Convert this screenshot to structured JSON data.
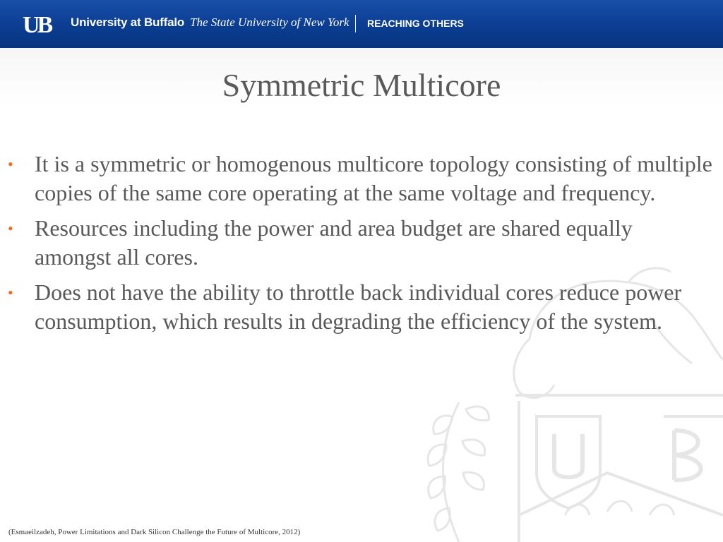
{
  "header": {
    "logo_text": "UB",
    "university": "University at Buffalo",
    "suny": "The State University of New York",
    "tagline": "REACHING OTHERS"
  },
  "slide": {
    "title": "Symmetric Multicore",
    "bullets": [
      "It is a symmetric or homogenous multicore topology consisting of multiple copies of the same core operating at the same voltage and frequency.",
      "Resources including the power and area budget are shared equally amongst all cores.",
      "Does not have the ability to throttle back individual cores reduce power consumption, which results in degrading the efficiency of the system."
    ],
    "bullet_symbol": "•",
    "citation": "(Esmaeilzadeh, Power Limitations and Dark Silicon Challenge the Future of Multicore, 2012)"
  },
  "colors": {
    "header_blue": "#0a3d91",
    "bullet_orange": "#f26b21",
    "text_gray": "#595959"
  },
  "icons": {
    "logo": "ub-logo-icon",
    "watermark": "buffalo-crest-watermark-icon"
  }
}
